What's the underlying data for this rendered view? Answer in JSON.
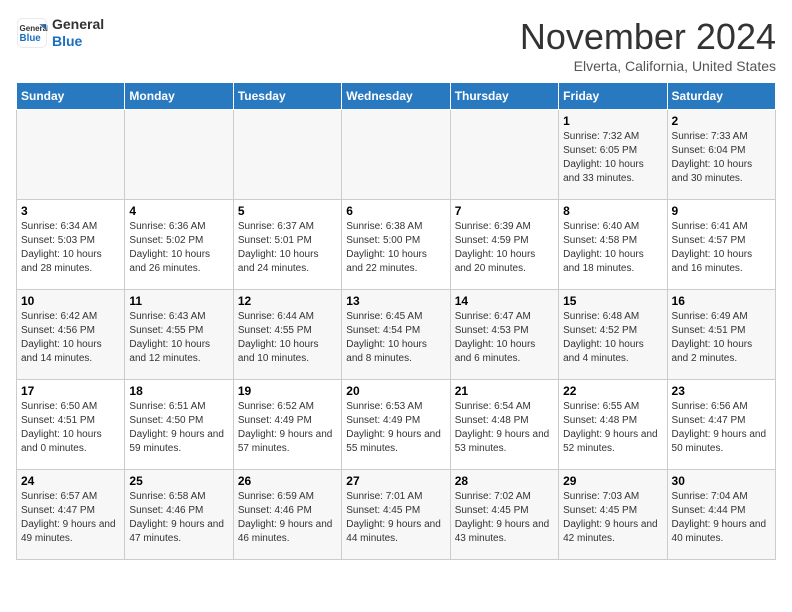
{
  "header": {
    "logo_line1": "General",
    "logo_line2": "Blue",
    "month": "November 2024",
    "location": "Elverta, California, United States"
  },
  "days_of_week": [
    "Sunday",
    "Monday",
    "Tuesday",
    "Wednesday",
    "Thursday",
    "Friday",
    "Saturday"
  ],
  "weeks": [
    [
      {
        "num": "",
        "info": ""
      },
      {
        "num": "",
        "info": ""
      },
      {
        "num": "",
        "info": ""
      },
      {
        "num": "",
        "info": ""
      },
      {
        "num": "",
        "info": ""
      },
      {
        "num": "1",
        "info": "Sunrise: 7:32 AM\nSunset: 6:05 PM\nDaylight: 10 hours and 33 minutes."
      },
      {
        "num": "2",
        "info": "Sunrise: 7:33 AM\nSunset: 6:04 PM\nDaylight: 10 hours and 30 minutes."
      }
    ],
    [
      {
        "num": "3",
        "info": "Sunrise: 6:34 AM\nSunset: 5:03 PM\nDaylight: 10 hours and 28 minutes."
      },
      {
        "num": "4",
        "info": "Sunrise: 6:36 AM\nSunset: 5:02 PM\nDaylight: 10 hours and 26 minutes."
      },
      {
        "num": "5",
        "info": "Sunrise: 6:37 AM\nSunset: 5:01 PM\nDaylight: 10 hours and 24 minutes."
      },
      {
        "num": "6",
        "info": "Sunrise: 6:38 AM\nSunset: 5:00 PM\nDaylight: 10 hours and 22 minutes."
      },
      {
        "num": "7",
        "info": "Sunrise: 6:39 AM\nSunset: 4:59 PM\nDaylight: 10 hours and 20 minutes."
      },
      {
        "num": "8",
        "info": "Sunrise: 6:40 AM\nSunset: 4:58 PM\nDaylight: 10 hours and 18 minutes."
      },
      {
        "num": "9",
        "info": "Sunrise: 6:41 AM\nSunset: 4:57 PM\nDaylight: 10 hours and 16 minutes."
      }
    ],
    [
      {
        "num": "10",
        "info": "Sunrise: 6:42 AM\nSunset: 4:56 PM\nDaylight: 10 hours and 14 minutes."
      },
      {
        "num": "11",
        "info": "Sunrise: 6:43 AM\nSunset: 4:55 PM\nDaylight: 10 hours and 12 minutes."
      },
      {
        "num": "12",
        "info": "Sunrise: 6:44 AM\nSunset: 4:55 PM\nDaylight: 10 hours and 10 minutes."
      },
      {
        "num": "13",
        "info": "Sunrise: 6:45 AM\nSunset: 4:54 PM\nDaylight: 10 hours and 8 minutes."
      },
      {
        "num": "14",
        "info": "Sunrise: 6:47 AM\nSunset: 4:53 PM\nDaylight: 10 hours and 6 minutes."
      },
      {
        "num": "15",
        "info": "Sunrise: 6:48 AM\nSunset: 4:52 PM\nDaylight: 10 hours and 4 minutes."
      },
      {
        "num": "16",
        "info": "Sunrise: 6:49 AM\nSunset: 4:51 PM\nDaylight: 10 hours and 2 minutes."
      }
    ],
    [
      {
        "num": "17",
        "info": "Sunrise: 6:50 AM\nSunset: 4:51 PM\nDaylight: 10 hours and 0 minutes."
      },
      {
        "num": "18",
        "info": "Sunrise: 6:51 AM\nSunset: 4:50 PM\nDaylight: 9 hours and 59 minutes."
      },
      {
        "num": "19",
        "info": "Sunrise: 6:52 AM\nSunset: 4:49 PM\nDaylight: 9 hours and 57 minutes."
      },
      {
        "num": "20",
        "info": "Sunrise: 6:53 AM\nSunset: 4:49 PM\nDaylight: 9 hours and 55 minutes."
      },
      {
        "num": "21",
        "info": "Sunrise: 6:54 AM\nSunset: 4:48 PM\nDaylight: 9 hours and 53 minutes."
      },
      {
        "num": "22",
        "info": "Sunrise: 6:55 AM\nSunset: 4:48 PM\nDaylight: 9 hours and 52 minutes."
      },
      {
        "num": "23",
        "info": "Sunrise: 6:56 AM\nSunset: 4:47 PM\nDaylight: 9 hours and 50 minutes."
      }
    ],
    [
      {
        "num": "24",
        "info": "Sunrise: 6:57 AM\nSunset: 4:47 PM\nDaylight: 9 hours and 49 minutes."
      },
      {
        "num": "25",
        "info": "Sunrise: 6:58 AM\nSunset: 4:46 PM\nDaylight: 9 hours and 47 minutes."
      },
      {
        "num": "26",
        "info": "Sunrise: 6:59 AM\nSunset: 4:46 PM\nDaylight: 9 hours and 46 minutes."
      },
      {
        "num": "27",
        "info": "Sunrise: 7:01 AM\nSunset: 4:45 PM\nDaylight: 9 hours and 44 minutes."
      },
      {
        "num": "28",
        "info": "Sunrise: 7:02 AM\nSunset: 4:45 PM\nDaylight: 9 hours and 43 minutes."
      },
      {
        "num": "29",
        "info": "Sunrise: 7:03 AM\nSunset: 4:45 PM\nDaylight: 9 hours and 42 minutes."
      },
      {
        "num": "30",
        "info": "Sunrise: 7:04 AM\nSunset: 4:44 PM\nDaylight: 9 hours and 40 minutes."
      }
    ]
  ]
}
